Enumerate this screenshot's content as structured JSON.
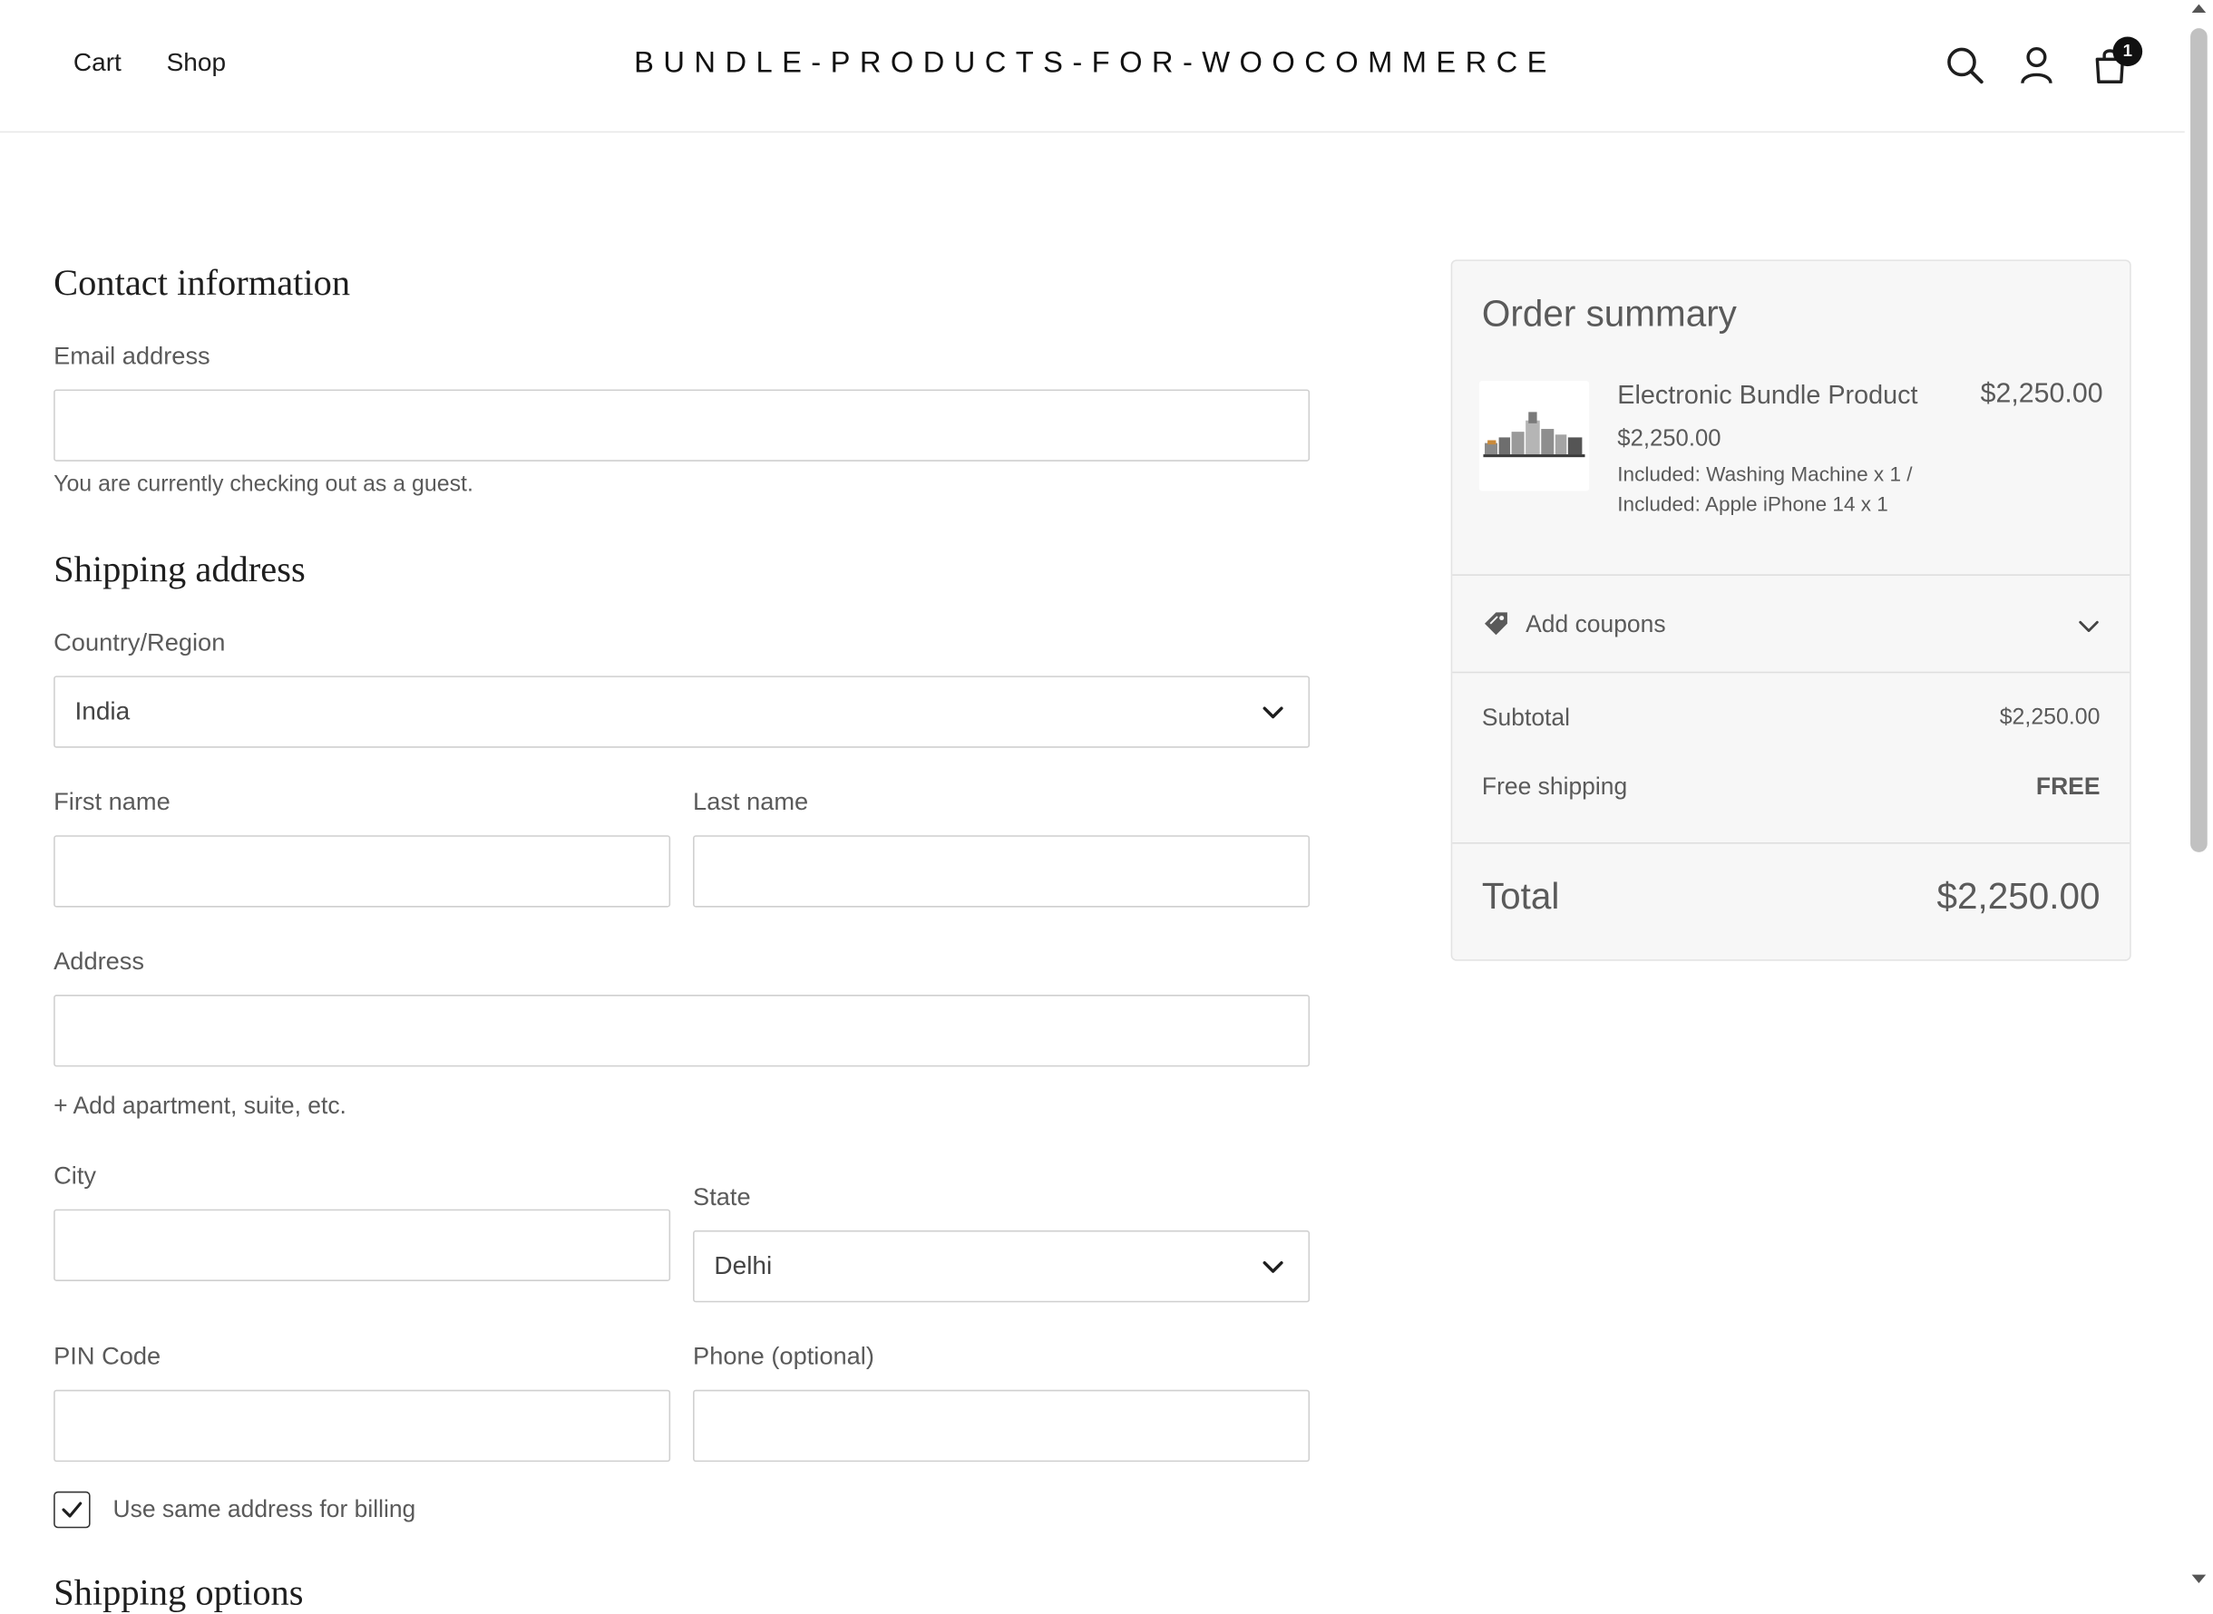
{
  "header": {
    "nav": [
      "Cart",
      "Shop"
    ],
    "site_title": "BUNDLE-PRODUCTS-FOR-WOOCOMMERCE",
    "cart_count": "1",
    "icons": [
      "search-icon",
      "account-icon",
      "cart-bag-icon"
    ]
  },
  "contact": {
    "heading": "Contact information",
    "email_label": "Email address",
    "email_value": "",
    "guest_note": "You are currently checking out as a guest."
  },
  "shipping": {
    "heading": "Shipping address",
    "country_label": "Country/Region",
    "country_value": "India",
    "first_name_label": "First name",
    "last_name_label": "Last name",
    "address_label": "Address",
    "add_apartment": "+ Add apartment, suite, etc.",
    "city_label": "City",
    "state_label": "State",
    "state_value": "Delhi",
    "pin_label": "PIN Code",
    "phone_label": "Phone (optional)",
    "same_billing_label": "Use same address for billing",
    "same_billing_checked": true,
    "next_heading": "Shipping options"
  },
  "summary": {
    "title": "Order summary",
    "item_name": "Electronic Bundle Product",
    "item_price": "$2,250.00",
    "item_unit_price": "$2,250.00",
    "included": [
      "Included: Washing Machine x 1 /",
      "Included: Apple iPhone 14 x 1"
    ],
    "add_coupons": "Add coupons",
    "subtotal_label": "Subtotal",
    "subtotal_value": "$2,250.00",
    "shipping_label": "Free shipping",
    "shipping_value": "FREE",
    "total_label": "Total",
    "total_value": "$2,250.00"
  }
}
